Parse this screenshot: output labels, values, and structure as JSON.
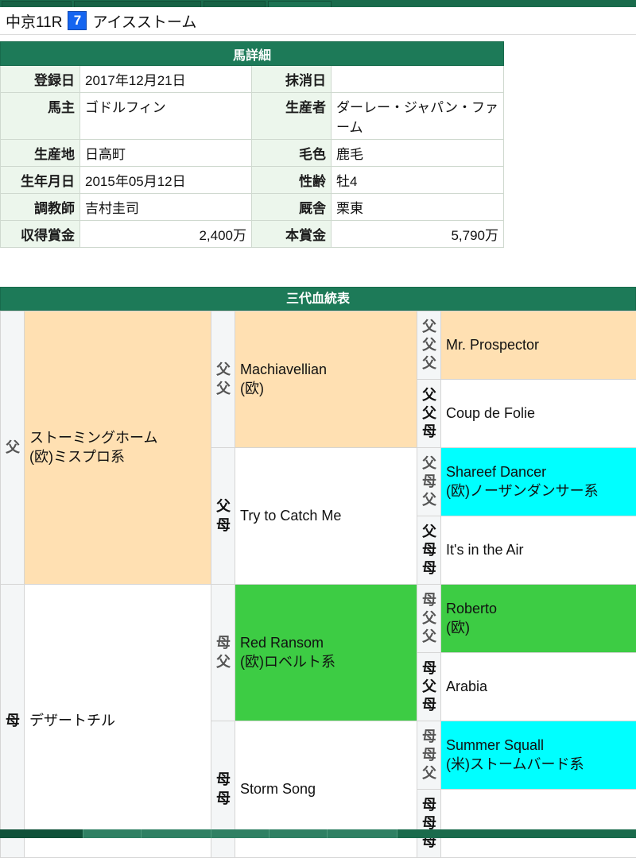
{
  "chrome": {
    "top_tabs": [
      "",
      "",
      "",
      ""
    ],
    "bottom_nav": [
      "",
      "",
      "",
      "",
      "",
      ""
    ]
  },
  "header": {
    "race": "中京11R",
    "horse_number": "7",
    "horse_name": "アイスストーム",
    "number_bg": "#1565f0"
  },
  "detail": {
    "title": "馬詳細",
    "rows": [
      {
        "l1": "登録日",
        "v1": "2017年12月21日",
        "l2": "抹消日",
        "v2": "",
        "align1": "left",
        "align2": "left"
      },
      {
        "l1": "馬主",
        "v1": "ゴドルフィン",
        "l2": "生産者",
        "v2": "ダーレー・ジャパン・ファーム",
        "align1": "left",
        "align2": "left"
      },
      {
        "l1": "生産地",
        "v1": "日高町",
        "l2": "毛色",
        "v2": "鹿毛",
        "align1": "left",
        "align2": "left"
      },
      {
        "l1": "生年月日",
        "v1": "2015年05月12日",
        "l2": "性齢",
        "v2": "牡4",
        "align1": "left",
        "align2": "left"
      },
      {
        "l1": "調教師",
        "v1": "吉村圭司",
        "l2": "厩舎",
        "v2": "栗東",
        "align1": "left",
        "align2": "left"
      },
      {
        "l1": "収得賞金",
        "v1": "2,400万",
        "l2": "本賞金",
        "v2": "5,790万",
        "align1": "right",
        "align2": "right"
      }
    ]
  },
  "pedigree": {
    "title": "三代血統表",
    "colors": {
      "orange": "#ffe0b2",
      "green": "#3dcc44",
      "cyan": "#00ffff",
      "white": "#ffffff"
    },
    "gen1": [
      {
        "rel": "父",
        "name": "ストーミングホーム",
        "line": "(欧)ミスプロ系",
        "bg": "orange"
      },
      {
        "rel": "母",
        "name": "デザートチル",
        "line": "",
        "bg": "white"
      }
    ],
    "gen2": [
      {
        "rel": "父父",
        "name": "Machiavellian",
        "line": "(欧)",
        "bg": "orange"
      },
      {
        "rel": "父母",
        "name": "Try to Catch Me",
        "line": "",
        "bg": "white"
      },
      {
        "rel": "母父",
        "name": "Red Ransom",
        "line": "(欧)ロベルト系",
        "bg": "green"
      },
      {
        "rel": "母母",
        "name": "Storm Song",
        "line": "",
        "bg": "white"
      }
    ],
    "gen3": [
      {
        "rel": "父父父",
        "name": "Mr. Prospector",
        "line": "",
        "bg": "orange"
      },
      {
        "rel": "父父母",
        "name": "Coup de Folie",
        "line": "",
        "bg": "white"
      },
      {
        "rel": "父母父",
        "name": "Shareef Dancer",
        "line": "(欧)ノーザンダンサー系",
        "bg": "cyan"
      },
      {
        "rel": "父母母",
        "name": "It's in the Air",
        "line": "",
        "bg": "white"
      },
      {
        "rel": "母父父",
        "name": "Roberto",
        "line": "(欧)",
        "bg": "green"
      },
      {
        "rel": "母父母",
        "name": "Arabia",
        "line": "",
        "bg": "white"
      },
      {
        "rel": "母母父",
        "name": "Summer Squall",
        "line": "(米)ストームバード系",
        "bg": "cyan"
      },
      {
        "rel": "母母母",
        "name": "",
        "line": "",
        "bg": "white"
      }
    ]
  }
}
